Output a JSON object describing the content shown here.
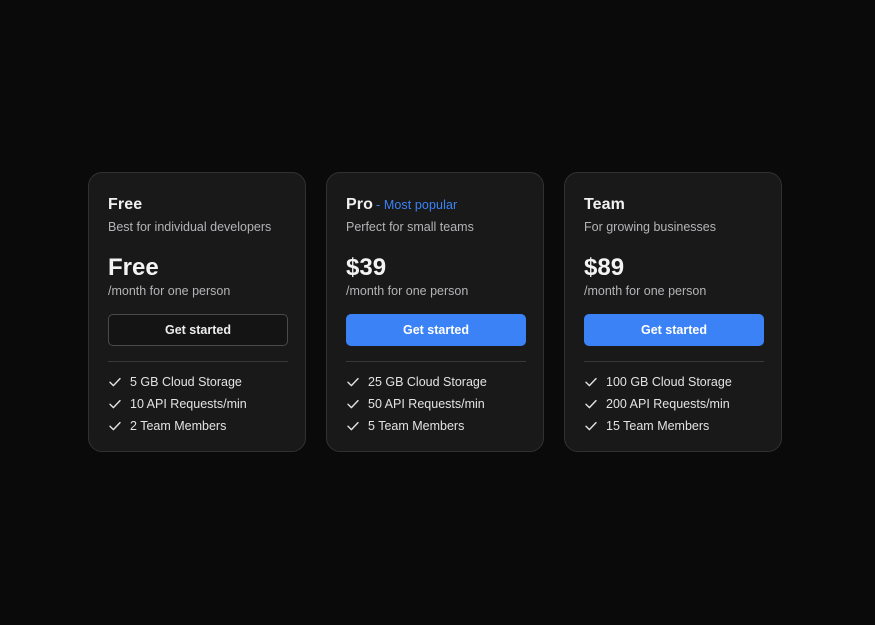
{
  "plans": [
    {
      "name": "Free",
      "badge": "",
      "description": "Best for individual developers",
      "price": "Free",
      "period": "/month for one person",
      "cta": "Get started",
      "cta_style": "outline",
      "features": [
        "5 GB Cloud Storage",
        "10 API Requests/min",
        "2 Team Members"
      ]
    },
    {
      "name": "Pro",
      "badge": "- Most popular",
      "description": "Perfect for small teams",
      "price": "$39",
      "period": "/month for one person",
      "cta": "Get started",
      "cta_style": "primary",
      "features": [
        "25 GB Cloud Storage",
        "50 API Requests/min",
        "5 Team Members"
      ]
    },
    {
      "name": "Team",
      "badge": "",
      "description": "For growing businesses",
      "price": "$89",
      "period": "/month for one person",
      "cta": "Get started",
      "cta_style": "primary",
      "features": [
        "100 GB Cloud Storage",
        "200 API Requests/min",
        "15 Team Members"
      ]
    }
  ],
  "icons": {
    "feature": "check-icon"
  },
  "colors": {
    "background": "#0b0a0a",
    "card": "#19191a",
    "accent": "#3b82f6"
  }
}
